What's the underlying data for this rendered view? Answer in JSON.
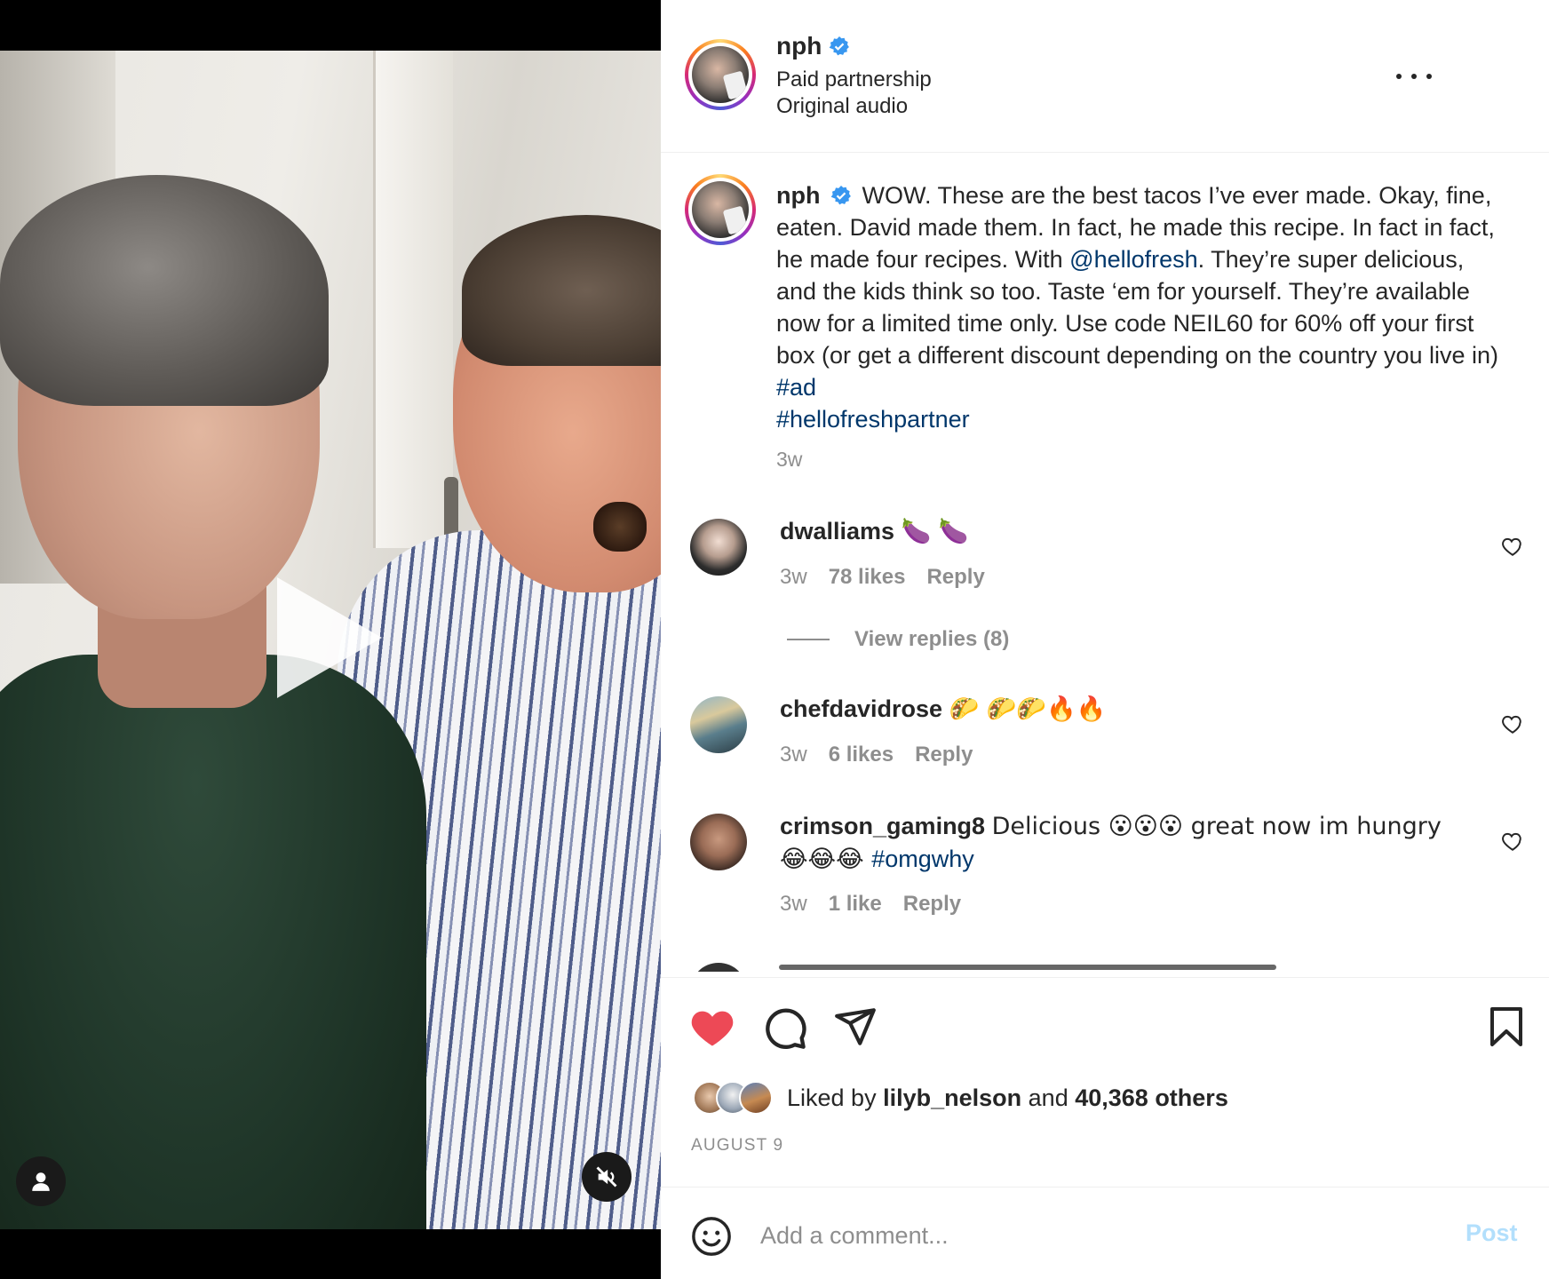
{
  "header": {
    "username": "nph",
    "line1": "Paid partnership",
    "line2": "Original audio"
  },
  "caption": {
    "username": "nph",
    "text_1": "WOW. These are the best tacos I’ve ever made. Okay, fine, eaten. David made them. In fact, he made this recipe. In fact in fact, he made four recipes. With ",
    "mention": "@hellofresh",
    "text_2": ". They’re super delicious, and the kids think so too. Taste ‘em for yourself. They’re available now for a limited time only. Use code NEIL60 for 60% off your first box (or get a different discount depending on the country you live in) ",
    "hashtag_1": "#ad",
    "hashtag_2": "#hellofreshpartner",
    "time": "3w"
  },
  "comments": [
    {
      "username": "dwalliams",
      "text": "🍆 🍆",
      "time": "3w",
      "likes": "78 likes",
      "reply": "Reply"
    },
    {
      "username": "chefdavidrose",
      "text": "🌮 🌮🌮🔥🔥",
      "time": "3w",
      "likes": "6 likes",
      "reply": "Reply"
    },
    {
      "username": "crimson_gaming8",
      "text": "Delicious 😮😮😮 great now im hungry 😂😂😂 ",
      "hashtag": "#omgwhy",
      "time": "3w",
      "likes": "1 like",
      "reply": "Reply"
    }
  ],
  "view_replies": "View replies (8)",
  "likes": {
    "prefix": "Liked by",
    "user": "lilyb_nelson",
    "joiner": "and",
    "others": "40,368 others"
  },
  "date": "AUGUST 9",
  "add_comment": {
    "placeholder": "Add a comment...",
    "post": "Post"
  },
  "colors": {
    "like_red": "#ed4956",
    "link_blue": "#00376b",
    "verified_blue": "#3897f0",
    "post_disabled": "#b2dffc",
    "meta_gray": "#8e8e8e"
  }
}
